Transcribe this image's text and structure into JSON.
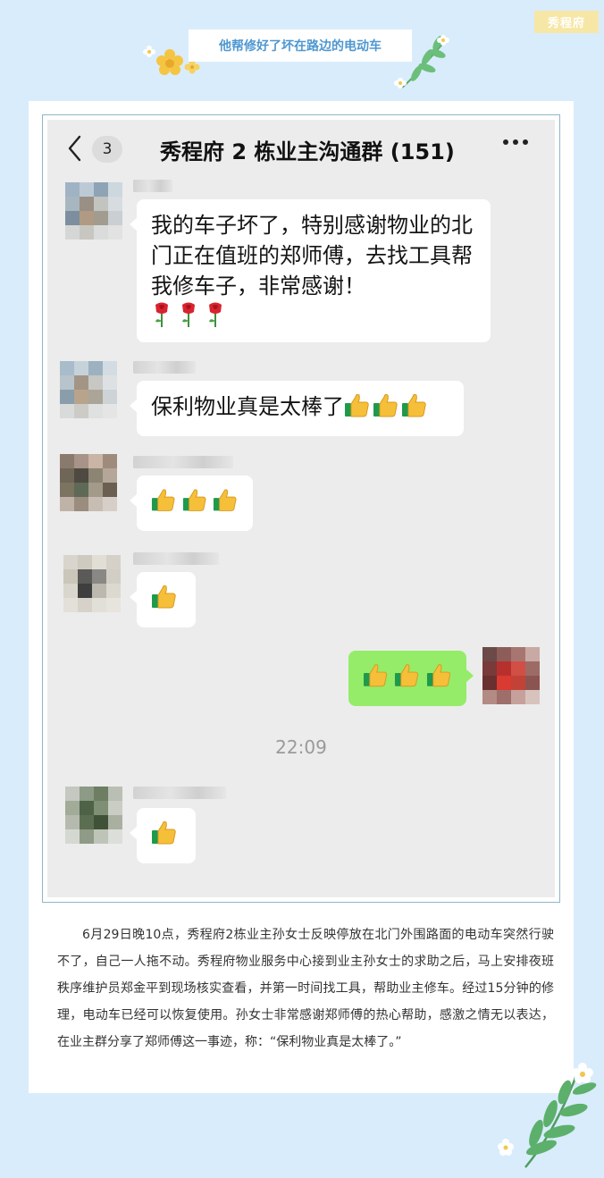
{
  "header": {
    "brand_tag": "秀程府",
    "headline": "他帮修好了坏在路边的电动车"
  },
  "chat": {
    "unread_count": "3",
    "title": "秀程府 2 栋业主沟通群 (151)",
    "messages": [
      {
        "text": "我的车子坏了，特别感谢物业的北门正在值班的郑师傅，去找工具帮我修车子，非常感谢！",
        "emoji": [
          "rose-icon",
          "rose-icon",
          "rose-icon"
        ]
      },
      {
        "text": "保利物业真是太棒了",
        "emoji": [
          "thumbs-up-icon",
          "thumbs-up-icon",
          "thumbs-up-icon"
        ]
      },
      {
        "emoji": [
          "thumbs-up-icon",
          "thumbs-up-icon",
          "thumbs-up-icon"
        ]
      },
      {
        "emoji": [
          "thumbs-up-icon"
        ]
      },
      {
        "emoji": [
          "thumbs-up-icon",
          "thumbs-up-icon",
          "thumbs-up-icon"
        ],
        "self": true
      },
      {
        "emoji": [
          "thumbs-up-icon"
        ]
      }
    ],
    "timestamp": "22:09"
  },
  "article": {
    "body": "6月29日晚10点，秀程府2栋业主孙女士反映停放在北门外围路面的电动车突然行驶不了，自己一人拖不动。秀程府物业服务中心接到业主孙女士的求助之后，马上安排夜班秩序维护员郑金平到现场核实查看，并第一时间找工具，帮助业主修车。经过15分钟的修理，电动车已经可以恢复使用。孙女士非常感谢郑师傅的热心帮助，感激之情无以表达，在业主群分享了郑师傅这一事迹，称：“保利物业真是太棒了。”"
  },
  "colors": {
    "page_bg": "#d9ecfb",
    "headline_text": "#4e97d1",
    "tag_bg": "#f7e7a6",
    "chat_bg": "#ececec",
    "self_bubble": "#95ec69"
  }
}
